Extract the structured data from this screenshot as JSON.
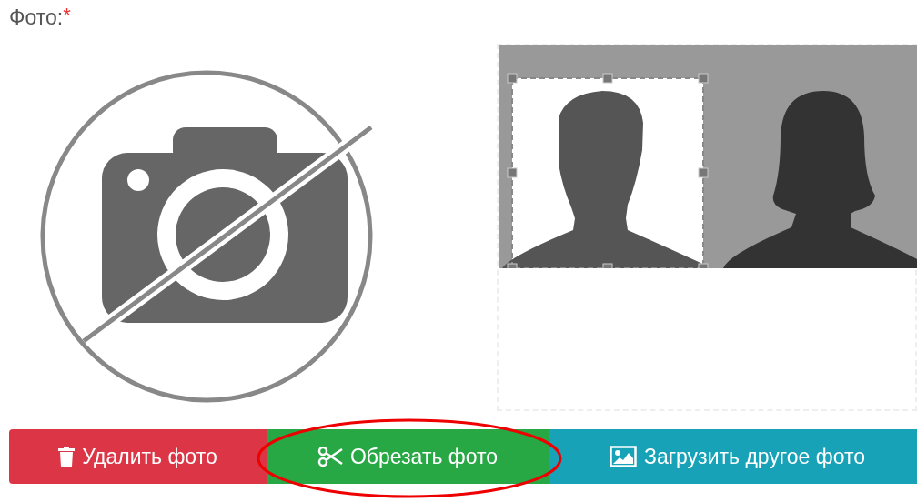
{
  "field": {
    "label": "Фото:",
    "required_mark": "*"
  },
  "buttons": [
    {
      "kind": "delete",
      "label": "Удалить фото",
      "highlighted": false
    },
    {
      "kind": "crop",
      "label": "Обрезать фото",
      "highlighted": true
    },
    {
      "kind": "upload",
      "label": "Загрузить другое фото",
      "highlighted": false
    }
  ]
}
